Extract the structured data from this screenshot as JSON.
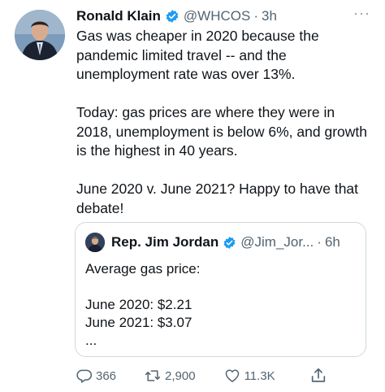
{
  "tweet": {
    "author_name": "Ronald Klain",
    "handle": "@WHCOS",
    "separator": "·",
    "time": "3h",
    "more_label": "···",
    "paragraphs": [
      "Gas was cheaper in 2020 because the pandemic limited travel -- and the unemployment rate was over 13%.",
      "Today: gas prices are where they were in 2018, unemployment is below 6%, and growth is the highest in 40 years.",
      "June 2020 v. June 2021?  Happy to have that debate!"
    ]
  },
  "quoted": {
    "author_name": "Rep. Jim Jordan",
    "handle": "@Jim_Jor...",
    "separator": "·",
    "time": "6h",
    "lines": [
      "Average gas price:",
      "June 2020: $2.21",
      "June 2021: $3.07",
      "..."
    ]
  },
  "actions": {
    "replies": "366",
    "retweets": "2,900",
    "likes": "11.3K"
  },
  "colors": {
    "verified_blue": "#1d9bf0",
    "muted_text": "#536471",
    "border": "#cfd9de"
  },
  "icons": [
    "verified-badge-icon",
    "more-icon",
    "reply-icon",
    "retweet-icon",
    "like-icon",
    "share-icon"
  ]
}
